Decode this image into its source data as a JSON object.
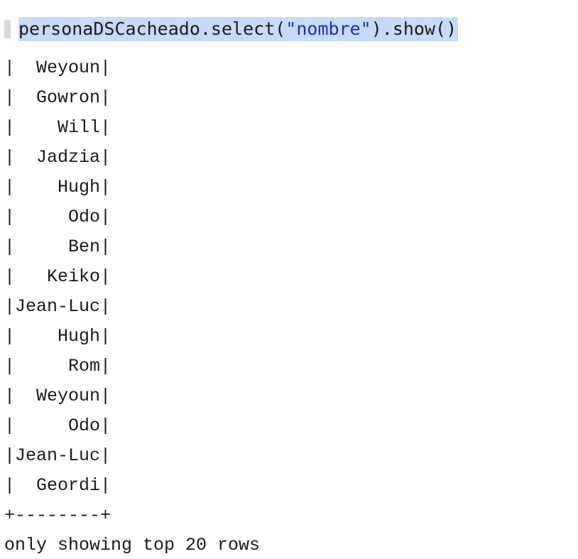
{
  "cell": {
    "code_prefix": "personaDSCacheado.select(",
    "code_string": "\"nombre\"",
    "code_suffix": ").show()"
  },
  "output": {
    "rows": [
      "|  Weyoun|",
      "|  Gowron|",
      "|    Will|",
      "|  Jadzia|",
      "|    Hugh|",
      "|     Odo|",
      "|     Ben|",
      "|   Keiko|",
      "|Jean-Luc|",
      "|    Hugh|",
      "|     Rom|",
      "|  Weyoun|",
      "|     Odo|",
      "|Jean-Luc|",
      "|  Geordi|"
    ],
    "border": "+--------+",
    "footer": "only showing top 20 rows"
  }
}
